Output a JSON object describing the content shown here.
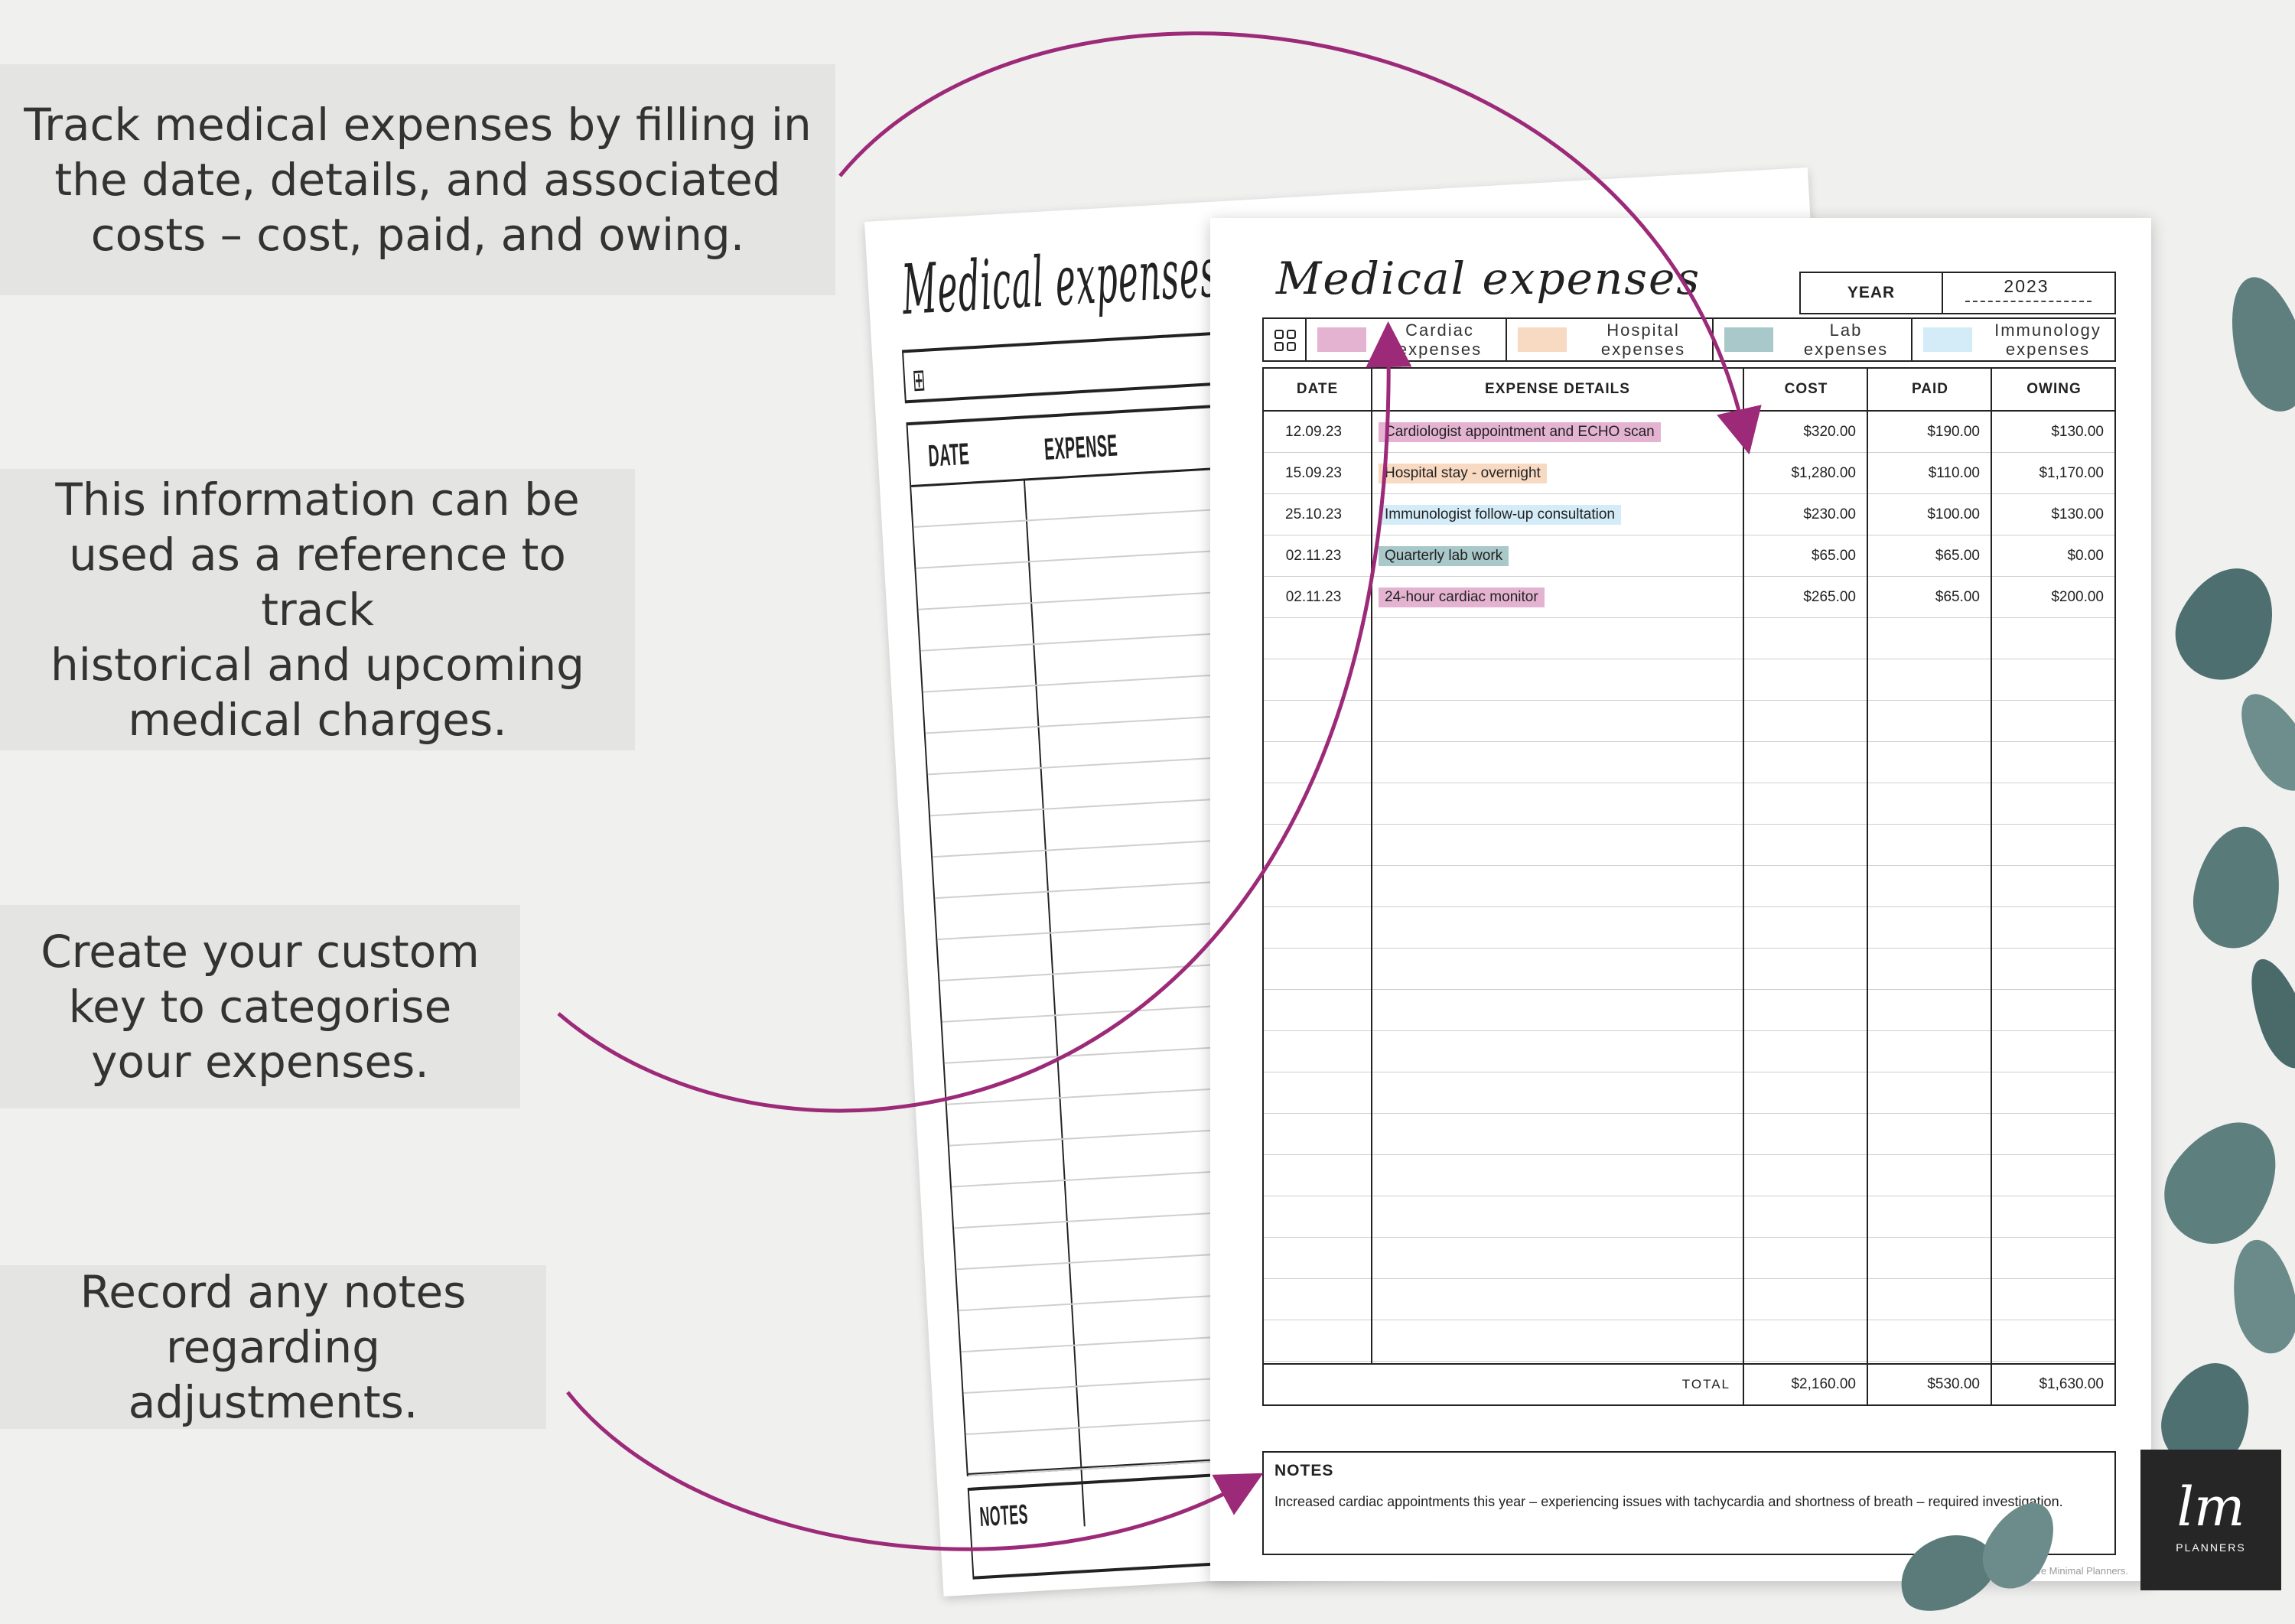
{
  "callouts": [
    "Track medical expenses by filling in\nthe date, details, and associated\ncosts – cost, paid, and owing.",
    "This information can be\nused as a reference to track\nhistorical and upcoming\nmedical charges.",
    "Create your custom\nkey to categorise\nyour expenses.",
    "Record any notes\nregarding adjustments."
  ],
  "back_sheet": {
    "title": "Medical expenses",
    "date_header": "DATE",
    "expense_header": "EXPENSE",
    "notes_label": "NOTES"
  },
  "sheet": {
    "title": "Medical expenses",
    "year_label": "YEAR",
    "year_value": "2023",
    "key": [
      {
        "label": "Cardiac\nexpenses",
        "color": "#e4b3d1"
      },
      {
        "label": "Hospital\nexpenses",
        "color": "#f8d9c2"
      },
      {
        "label": "Lab\nexpenses",
        "color": "#a9c8c9"
      },
      {
        "label": "Immunology\nexpenses",
        "color": "#d3ecf7"
      }
    ],
    "headers": {
      "date": "DATE",
      "details": "EXPENSE DETAILS",
      "cost": "COST",
      "paid": "PAID",
      "owing": "OWING"
    },
    "rows": [
      {
        "date": "12.09.23",
        "details": "Cardiologist appointment and ECHO scan",
        "category": 0,
        "cost": "$320.00",
        "paid": "$190.00",
        "owing": "$130.00"
      },
      {
        "date": "15.09.23",
        "details": "Hospital stay - overnight",
        "category": 1,
        "cost": "$1,280.00",
        "paid": "$110.00",
        "owing": "$1,170.00"
      },
      {
        "date": "25.10.23",
        "details": "Immunologist follow-up consultation",
        "category": 3,
        "cost": "$230.00",
        "paid": "$100.00",
        "owing": "$130.00"
      },
      {
        "date": "02.11.23",
        "details": "Quarterly lab work",
        "category": 2,
        "cost": "$65.00",
        "paid": "$65.00",
        "owing": "$0.00"
      },
      {
        "date": "02.11.23",
        "details": "24-hour cardiac monitor",
        "category": 0,
        "cost": "$265.00",
        "paid": "$65.00",
        "owing": "$200.00"
      }
    ],
    "total_label": "TOTAL",
    "totals": {
      "cost": "$2,160.00",
      "paid": "$530.00",
      "owing": "$1,630.00"
    },
    "notes_label": "NOTES",
    "notes_text": "Increased cardiac appointments this year – experiencing issues with tachycardia and shortness of breath – required investigation.",
    "copyright": "© Live Minimal Planners."
  },
  "logo": {
    "mark": "lm",
    "text": "PLANNERS"
  },
  "colors": {
    "arrow": "#9c2a78",
    "background": "#f0f0ef",
    "callout_bg": "#e4e4e3"
  }
}
